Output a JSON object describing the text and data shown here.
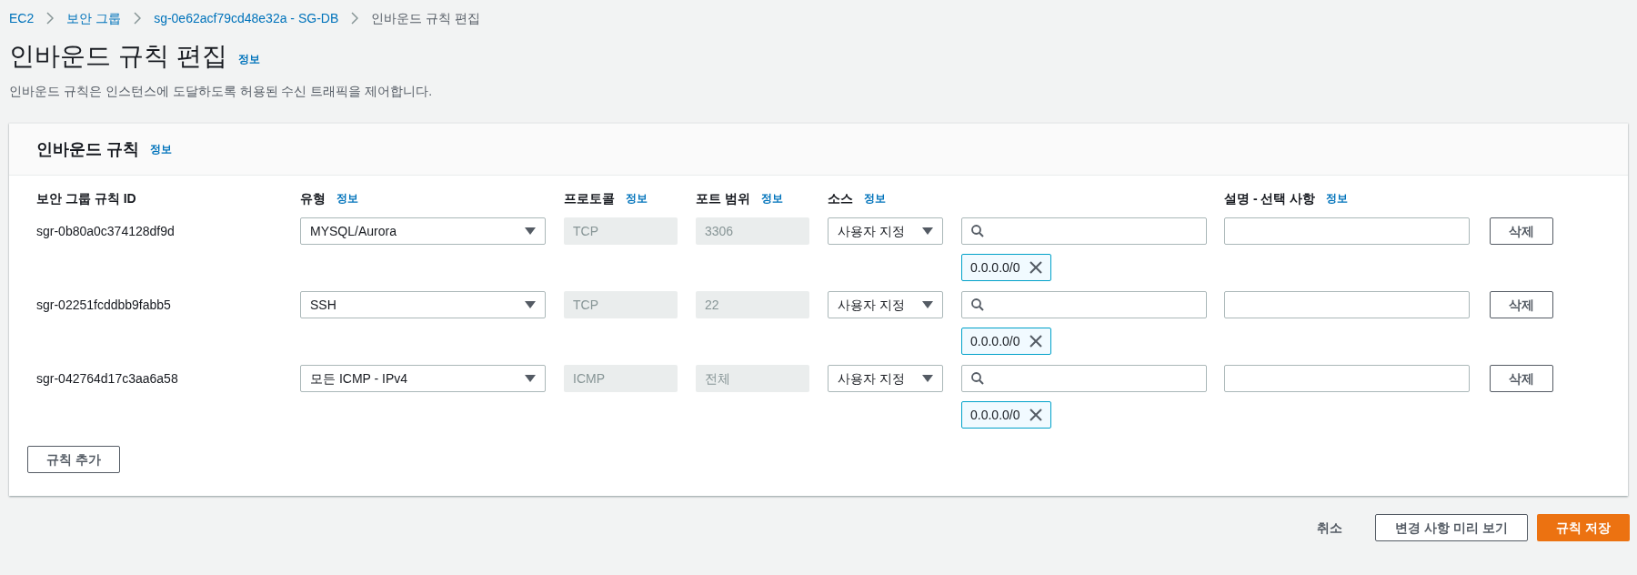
{
  "breadcrumb": [
    {
      "label": "EC2",
      "kind": "link"
    },
    {
      "label": "보안 그룹",
      "kind": "link"
    },
    {
      "label": "sg-0e62acf79cd48e32a - SG-DB",
      "kind": "link"
    },
    {
      "label": "인바운드 규칙 편집",
      "kind": "current"
    }
  ],
  "page": {
    "title": "인바운드 규칙 편집",
    "info": "정보",
    "description": "인바운드 규칙은 인스턴스에 도달하도록 허용된 수신 트래픽을 제어합니다."
  },
  "panel": {
    "title": "인바운드 규칙",
    "info": "정보",
    "columns": [
      {
        "label": "보안 그룹 규칙 ID"
      },
      {
        "label": "유형",
        "info": "정보"
      },
      {
        "label": "프로토콜",
        "info": "정보"
      },
      {
        "label": "포트 범위",
        "info": "정보"
      },
      {
        "label": "소스",
        "info": "정보"
      },
      {
        "label": "설명 - 선택 사항",
        "info": "정보"
      }
    ],
    "rows": [
      {
        "id": "sgr-0b80a0c374128df9d",
        "type": "MYSQL/Aurora",
        "protocol": "TCP",
        "port": "3306",
        "source": "사용자 지정",
        "cidrs": [
          "0.0.0.0/0"
        ],
        "delete": "삭제"
      },
      {
        "id": "sgr-02251fcddbb9fabb5",
        "type": "SSH",
        "protocol": "TCP",
        "port": "22",
        "source": "사용자 지정",
        "cidrs": [
          "0.0.0.0/0"
        ],
        "delete": "삭제"
      },
      {
        "id": "sgr-042764d17c3aa6a58",
        "type": "모든 ICMP - IPv4",
        "protocol": "ICMP",
        "port": "전체",
        "source": "사용자 지정",
        "cidrs": [
          "0.0.0.0/0"
        ],
        "delete": "삭제"
      }
    ],
    "add_button": "규칙 추가"
  },
  "footer": [
    {
      "label": "취소",
      "kind": "link"
    },
    {
      "label": "변경 사항 미리 보기",
      "kind": "normal"
    },
    {
      "label": "규칙 저장",
      "kind": "primary"
    }
  ]
}
